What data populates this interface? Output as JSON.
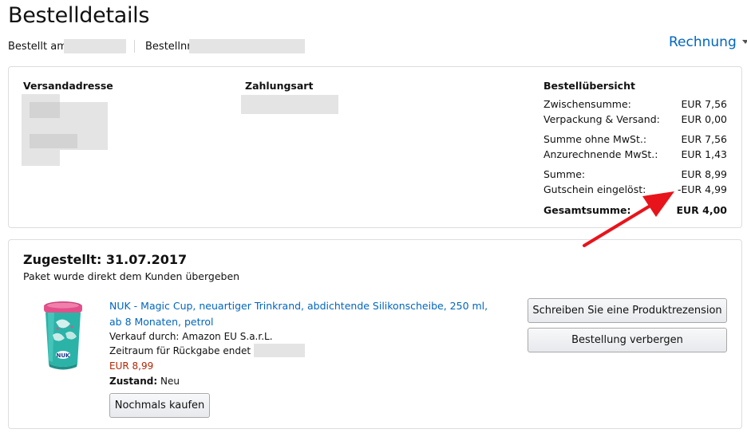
{
  "header": {
    "title": "Bestelldetails",
    "ordered_on_label": "Bestellt am",
    "order_number_label": "Bestellnr.",
    "invoice_label": "Rechnung"
  },
  "summary": {
    "shipping_address_heading": "Versandadresse",
    "payment_heading": "Zahlungsart",
    "overview_heading": "Bestellübersicht",
    "rows": [
      {
        "label": "Zwischensumme:",
        "value": "EUR 7,56"
      },
      {
        "label": "Verpackung & Versand:",
        "value": "EUR 0,00"
      },
      {
        "label": "Summe ohne MwSt.:",
        "value": "EUR 7,56"
      },
      {
        "label": "Anzurechnende MwSt.:",
        "value": "EUR 1,43"
      },
      {
        "label": "Summe:",
        "value": "EUR 8,99"
      },
      {
        "label": "Gutschein eingelöst:",
        "value": "-EUR 4,99"
      }
    ],
    "total": {
      "label": "Gesamtsumme:",
      "value": "EUR 4,00"
    }
  },
  "shipment": {
    "status_heading": "Zugestellt: 31.07.2017",
    "status_detail": "Paket wurde direkt dem Kunden übergeben",
    "product_title": "NUK - Magic Cup, neuartiger Trinkrand, abdichtende Silikonscheibe, 250 ml, ab 8 Monaten, petrol",
    "sold_by": "Verkauf durch: Amazon EU S.a.r.L.",
    "return_window": "Zeitraum für Rückgabe endet am",
    "price": "EUR 8,99",
    "condition_label": "Zustand:",
    "condition_value": "Neu",
    "buy_again_label": "Nochmals kaufen",
    "review_button_label": "Schreiben Sie eine Produktrezension",
    "hide_order_button_label": "Bestellung verbergen",
    "product_logo_text": "NUK"
  },
  "colors": {
    "link": "#0066c0",
    "price": "#b12704",
    "annotation_arrow": "#e8141b",
    "cup_body": "#2bb3a8",
    "cup_lid": "#e2508a"
  },
  "icons": [
    "chevron-down-icon",
    "annotation-arrow-icon",
    "product-image"
  ]
}
